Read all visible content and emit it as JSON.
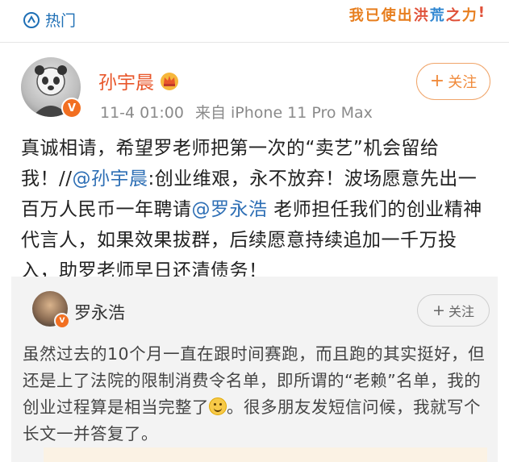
{
  "header": {
    "hot_label": "热门",
    "slogan_chars": [
      "我",
      "已",
      "使",
      "出",
      "洪",
      "荒",
      "之",
      "力",
      "!"
    ]
  },
  "post": {
    "username": "孙宇晨",
    "time": "11-4 01:00",
    "source": "来自 iPhone 11 Pro Max",
    "follow_label": "关注",
    "text_part1": "真诚相请，希望罗老师把第一次的“卖艺”机会留给我！//",
    "mention1": "@孙宇晨",
    "text_part2": ":创业维艰，永不放弃！波场愿意先出一百万人民币一年聘请",
    "mention2": "@罗永浩",
    "text_part3": " 老师担任我们的创业精神代言人，如果效果拔群，后续愿意持续追加一千万投入，助罗老师早日还清债务！"
  },
  "quoted": {
    "username": "罗永浩",
    "follow_label": "关注",
    "text_part1": "虽然过去的10个月一直在跟时间赛跑，而且跑的其实挺好，但还是上了法院的限制消费令名单，即所谓的“老赖”名单，我的创业过程算是相当完整了",
    "text_part2": "。很多朋友发短信问候，我就写个长文一并答复了。"
  },
  "colors": {
    "accent_orange": "#f08a3a",
    "username_red": "#e8562a",
    "link_blue": "#2e6fb5",
    "quote_bg": "#f3f3f3"
  },
  "icons": [
    "hot-topic-icon",
    "crown-icon",
    "verified-badge-icon",
    "plus-icon",
    "smile-emoji-icon"
  ]
}
